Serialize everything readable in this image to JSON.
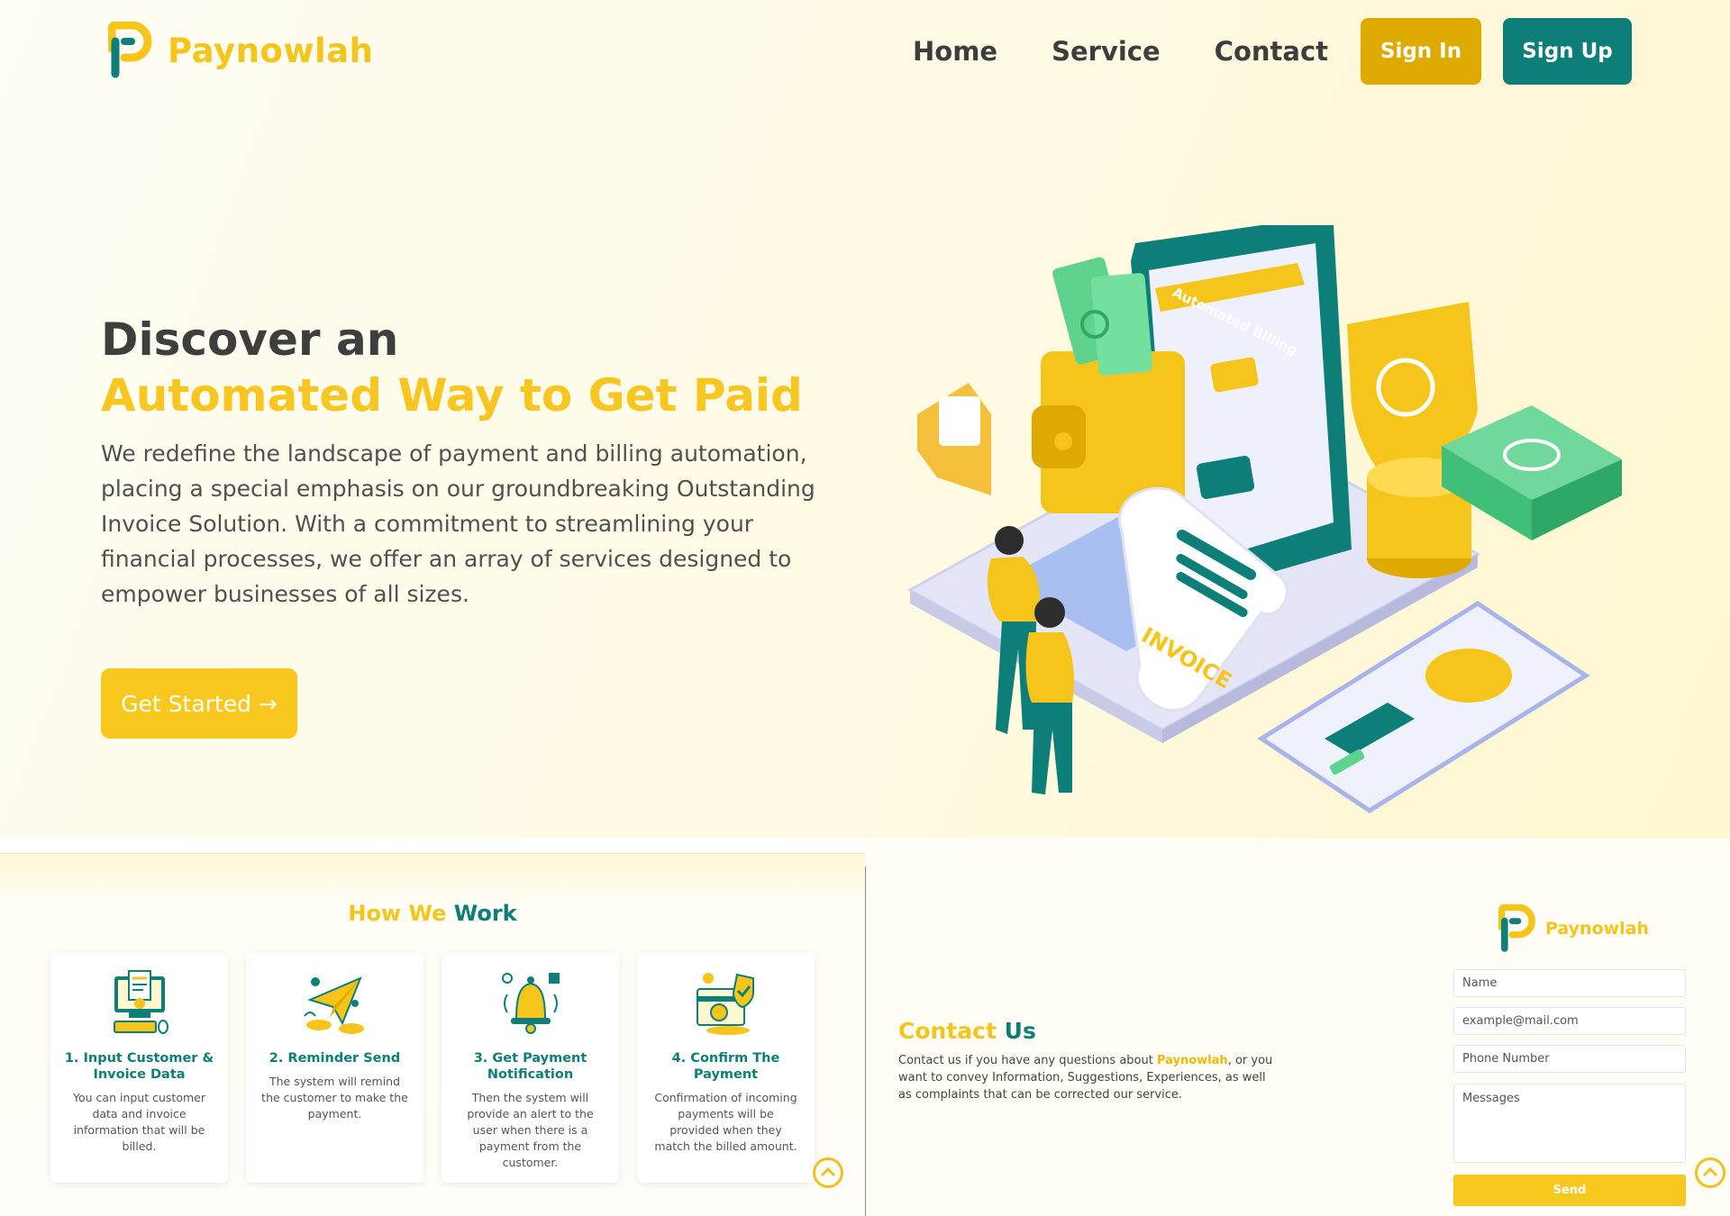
{
  "brand": {
    "name": "Paynowlah",
    "primary_color": "#f6c51b",
    "secondary_color": "#0d7f78"
  },
  "nav": {
    "home": "Home",
    "service": "Service",
    "contact": "Contact",
    "sign_in": "Sign In",
    "sign_up": "Sign Up"
  },
  "hero": {
    "title_line1": "Discover an",
    "title_line2": "Automated Way to Get Paid",
    "description": "We redefine the landscape of payment and billing automation, placing a special emphasis on our groundbreaking Outstanding Invoice Solution. With a commitment to streamlining your financial processes, we offer an array of services designed to empower businesses of all sizes.",
    "cta": "Get Started →",
    "illustration_labels": {
      "screen_banner": "Automated Billing",
      "receipt": "INVOICE"
    }
  },
  "how_we_work": {
    "title_part1": "How We",
    "title_part2": "Work",
    "steps": [
      {
        "title": "1. Input Customer & Invoice Data",
        "text": "You can input customer data and invoice information that will be billed.",
        "icon": "computer-data-icon"
      },
      {
        "title": "2. Reminder Send",
        "text": "The system will remind the customer to make the payment.",
        "icon": "paper-plane-icon"
      },
      {
        "title": "3. Get Payment Notification",
        "text": "Then the system will provide an alert to the user when there is a payment from the customer.",
        "icon": "bell-icon"
      },
      {
        "title": "4. Confirm The Payment",
        "text": "Confirmation of incoming payments will be provided when they match the billed amount.",
        "icon": "payment-shield-icon"
      }
    ]
  },
  "contact": {
    "title_part1": "Contact",
    "title_part2": "Us",
    "text_before": "Contact us if you have any questions about ",
    "text_brand": "Paynowlah",
    "text_after": ", or you want to convey Information, Suggestions, Experiences, as well as complaints that can be corrected our service.",
    "form": {
      "name_placeholder": "Name",
      "email_placeholder": "example@mail.com",
      "phone_placeholder": "Phone Number",
      "message_placeholder": "Messages",
      "send": "Send"
    }
  }
}
